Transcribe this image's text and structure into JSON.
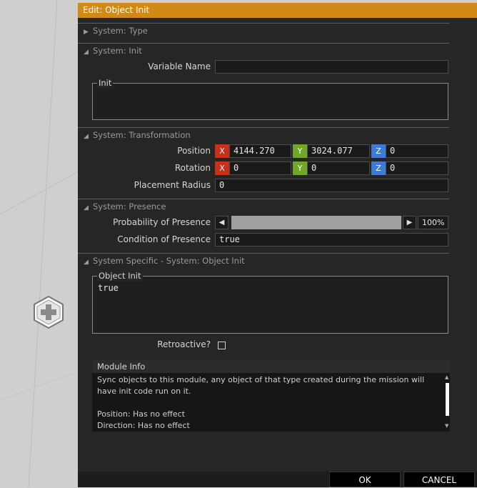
{
  "dialog": {
    "title": "Edit: Object Init",
    "ok_label": "OK",
    "cancel_label": "CANCEL"
  },
  "sections": {
    "type": {
      "title": "System: Type"
    },
    "init": {
      "title": "System: Init",
      "variable_name_label": "Variable Name",
      "variable_name_value": "",
      "init_label": "Init",
      "init_value": ""
    },
    "transformation": {
      "title": "System: Transformation",
      "position_label": "Position",
      "position": {
        "x": "4144.270",
        "y": "3024.077",
        "z": "0"
      },
      "rotation_label": "Rotation",
      "rotation": {
        "x": "0",
        "y": "0",
        "z": "0"
      },
      "axis_x": "X",
      "axis_y": "Y",
      "axis_z": "Z",
      "placement_radius_label": "Placement Radius",
      "placement_radius_value": "0"
    },
    "presence": {
      "title": "System: Presence",
      "probability_label": "Probability of Presence",
      "probability_value": "100%",
      "probability_fraction": 1.0,
      "condition_label": "Condition of Presence",
      "condition_value": "true"
    },
    "specific": {
      "title": "System Specific - System: Object Init",
      "object_init_label": "Object Init",
      "object_init_value": "true",
      "retroactive_label": "Retroactive?",
      "retroactive_checked": false
    }
  },
  "module_info": {
    "title": "Module Info",
    "line1": "Sync objects to this module, any object of that type created during the mission will have init code run on it.",
    "line2": "Position: Has no effect",
    "line3": "Direction: Has no effect"
  },
  "colors": {
    "title_bar": "#d08a17",
    "axis_x": "#c8301d",
    "axis_y": "#6ea729",
    "axis_z": "#3e7bd4"
  },
  "icons": {
    "marker": "add-module-icon"
  }
}
